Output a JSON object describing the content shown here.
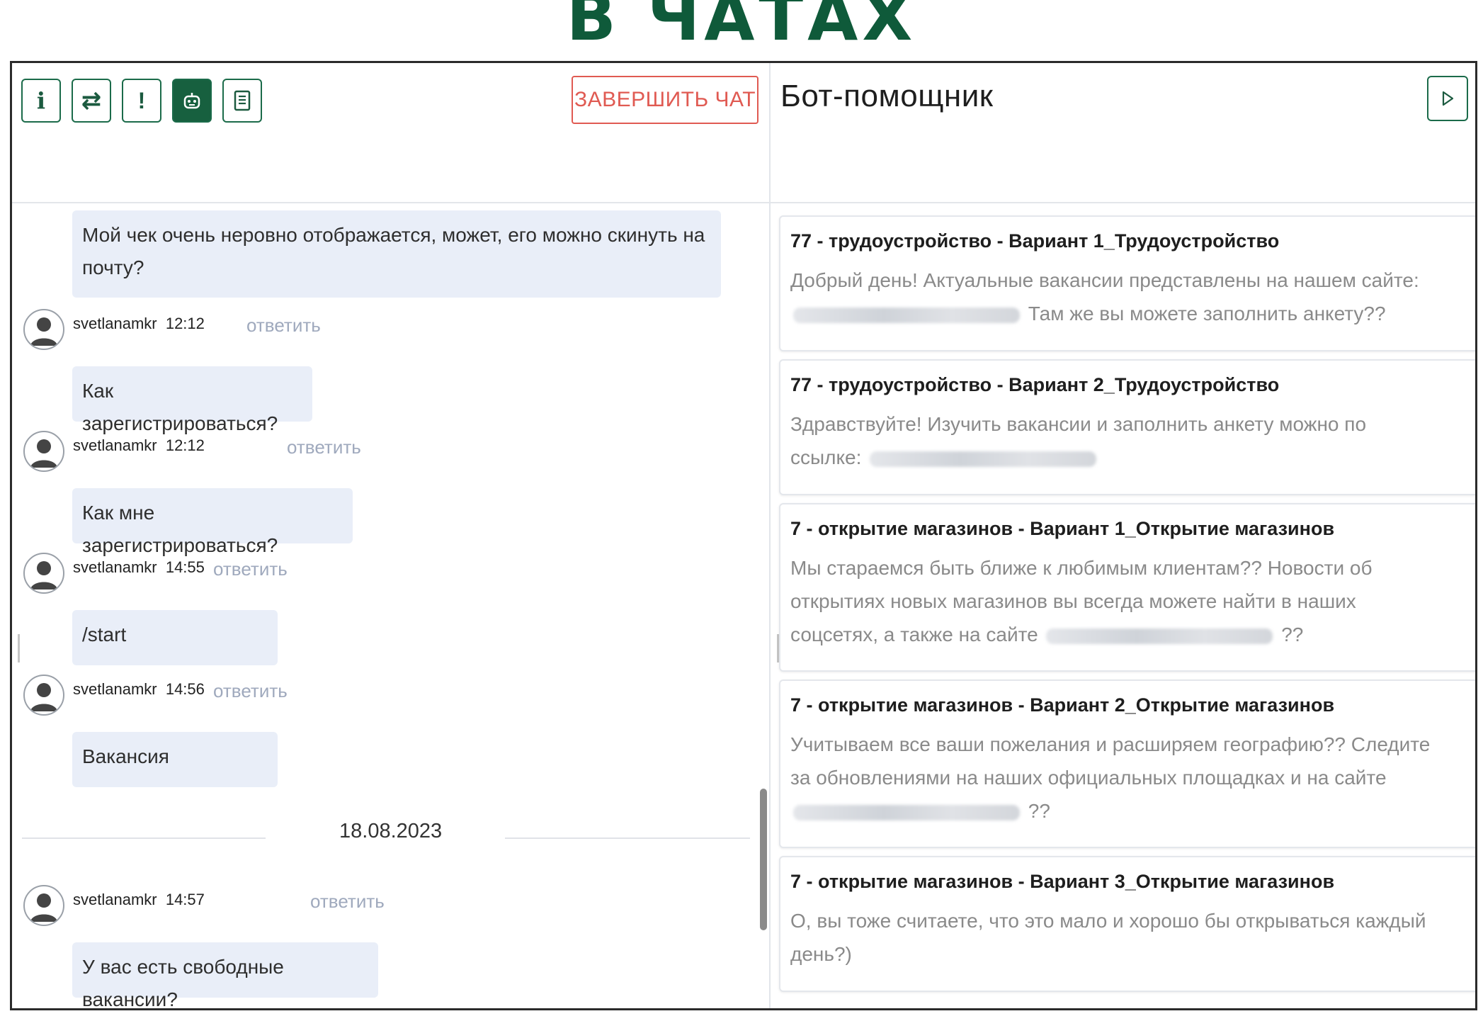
{
  "banner": {
    "text": "В ЧАТАХ"
  },
  "toolbar": {
    "buttons": [
      {
        "icon": "info-icon",
        "glyph": "i"
      },
      {
        "icon": "transfer-icon",
        "glyph": "⇄"
      },
      {
        "icon": "exclamation-icon",
        "glyph": "!"
      },
      {
        "icon": "bot-icon",
        "glyph": ""
      },
      {
        "icon": "document-icon",
        "glyph": ""
      }
    ],
    "end_chat_label": "ЗАВЕРШИТЬ ЧАТ"
  },
  "chat": {
    "messages": [
      {
        "text": "Мой чек очень неровно отображается, может, его можно скинуть на почту?"
      },
      {
        "user": "svetlanamkr",
        "time": "12:12",
        "reply": "ответить",
        "text": "Как зарегистрироваться?"
      },
      {
        "user": "svetlanamkr",
        "time": "12:12",
        "reply": "ответить",
        "text": "Как мне зарегистрироваться?"
      },
      {
        "user": "svetlanamkr",
        "time": "14:55",
        "reply": "ответить",
        "text": "/start"
      },
      {
        "user": "svetlanamkr",
        "time": "14:56",
        "reply": "ответить",
        "text": "Вакансия"
      },
      {
        "user": "svetlanamkr",
        "time": "14:57",
        "reply": "ответить",
        "text": "У вас есть свободные вакансии?"
      }
    ],
    "date_separator": "18.08.2023"
  },
  "bot": {
    "title": "Бот-помощник",
    "cards": [
      {
        "title": "77 - трудоустройство - Вариант 1_Трудоустройство",
        "line1": "Добрый день! Актуальные вакансии представлены на нашем сайте:",
        "line2": "Там же вы можете заполнить анкету??"
      },
      {
        "title": "77 - трудоустройство - Вариант 2_Трудоустройство",
        "line1": "Здравствуйте! Изучить вакансии и заполнить анкету можно по",
        "line2": "ссылке:"
      },
      {
        "title": "7 - открытие магазинов - Вариант 1_Открытие магазинов",
        "line1": "Мы стараемся быть ближе к любимым клиентам?? Новости об",
        "line2": "открытиях новых магазинов вы всегда можете найти в наших",
        "line3": "соцсетях, а также на сайте",
        "line3_end": "??"
      },
      {
        "title": "7 - открытие магазинов - Вариант 2_Открытие магазинов",
        "line1": "Учитываем все ваши пожелания и расширяем географию?? Следите",
        "line2": "за обновлениями на наших официальных площадках и на сайте",
        "line3_end": "??"
      },
      {
        "title": "7 - открытие магазинов - Вариант 3_Открытие магазинов",
        "line1": "О, вы тоже считаете, что это мало и хорошо бы открываться каждый",
        "line2": "день?)"
      }
    ]
  },
  "colors": {
    "accent": "#17603f",
    "danger": "#e05a52",
    "bubble": "#e9eef8",
    "muted": "#9fa9bd"
  }
}
